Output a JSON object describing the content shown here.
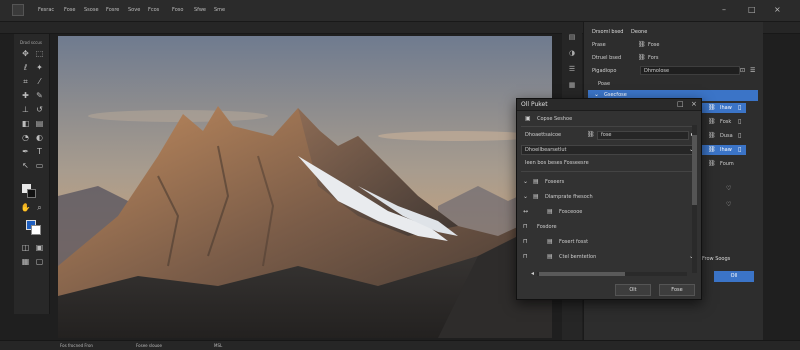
{
  "menubar": {
    "items": [
      "Fesrac",
      "Fose",
      "Ssose",
      "Fosre",
      "Sove",
      "Fcos",
      "Foso",
      "Sfwe",
      "Sme"
    ],
    "window_controls": [
      "–",
      "□",
      "×"
    ]
  },
  "toolbar": {
    "label": "Drod sccus"
  },
  "right_panel": {
    "header_tabs": [
      "Drsoml bsed",
      "Deone"
    ],
    "row1": {
      "label": "Prase",
      "value": "Fose"
    },
    "row2": {
      "label": "Dtruel bsed",
      "value": "Fors"
    },
    "row3": {
      "label": "Pigadiopo",
      "value": "Dhmolose"
    },
    "row4": {
      "label": "Poae"
    },
    "row5": {
      "label": "Gsecfose"
    },
    "list_items": [
      {
        "label": "Ihaw",
        "icon": "link-icon"
      },
      {
        "label": "Fosk",
        "icon": "link-icon"
      },
      {
        "label": "Dusa",
        "icon": "link-icon"
      },
      {
        "label": "Ihaw",
        "icon": "link-icon"
      },
      {
        "label": "Foum",
        "icon": "link-icon"
      }
    ],
    "bottom_label": "Frow Soogs",
    "ok_label": "Oll"
  },
  "dialog": {
    "title": "Oll Puket",
    "controls": [
      "□",
      "×"
    ],
    "header_row": "Copse Seshoe",
    "dropdown1": {
      "label": "Dhoaettsaicoe",
      "value": "fose"
    },
    "field2": {
      "label": "Dhoeilbearsetlut"
    },
    "field3": {
      "label": "Ieen bos beses Fosseesre"
    },
    "tree_items": [
      {
        "label": "Foseers",
        "icon": "chevron-down-icon"
      },
      {
        "label": "Dlamprate fhesoch",
        "icon": "chevron-down-icon"
      },
      {
        "label": "Fosceooe",
        "icon": "arrows-icon"
      },
      {
        "label": "Fosdore",
        "icon": "lock-icon"
      },
      {
        "label": "Fosert fosst",
        "icon": "lock-icon"
      },
      {
        "label": "Ctel bemtetlon",
        "icon": "lock-icon"
      }
    ],
    "buttons": {
      "ok": "Olt",
      "cancel": "Fose"
    }
  },
  "statusbar": {
    "items": [
      "Fos frocned Fron",
      "Fosee slouoe",
      "MSL"
    ]
  }
}
